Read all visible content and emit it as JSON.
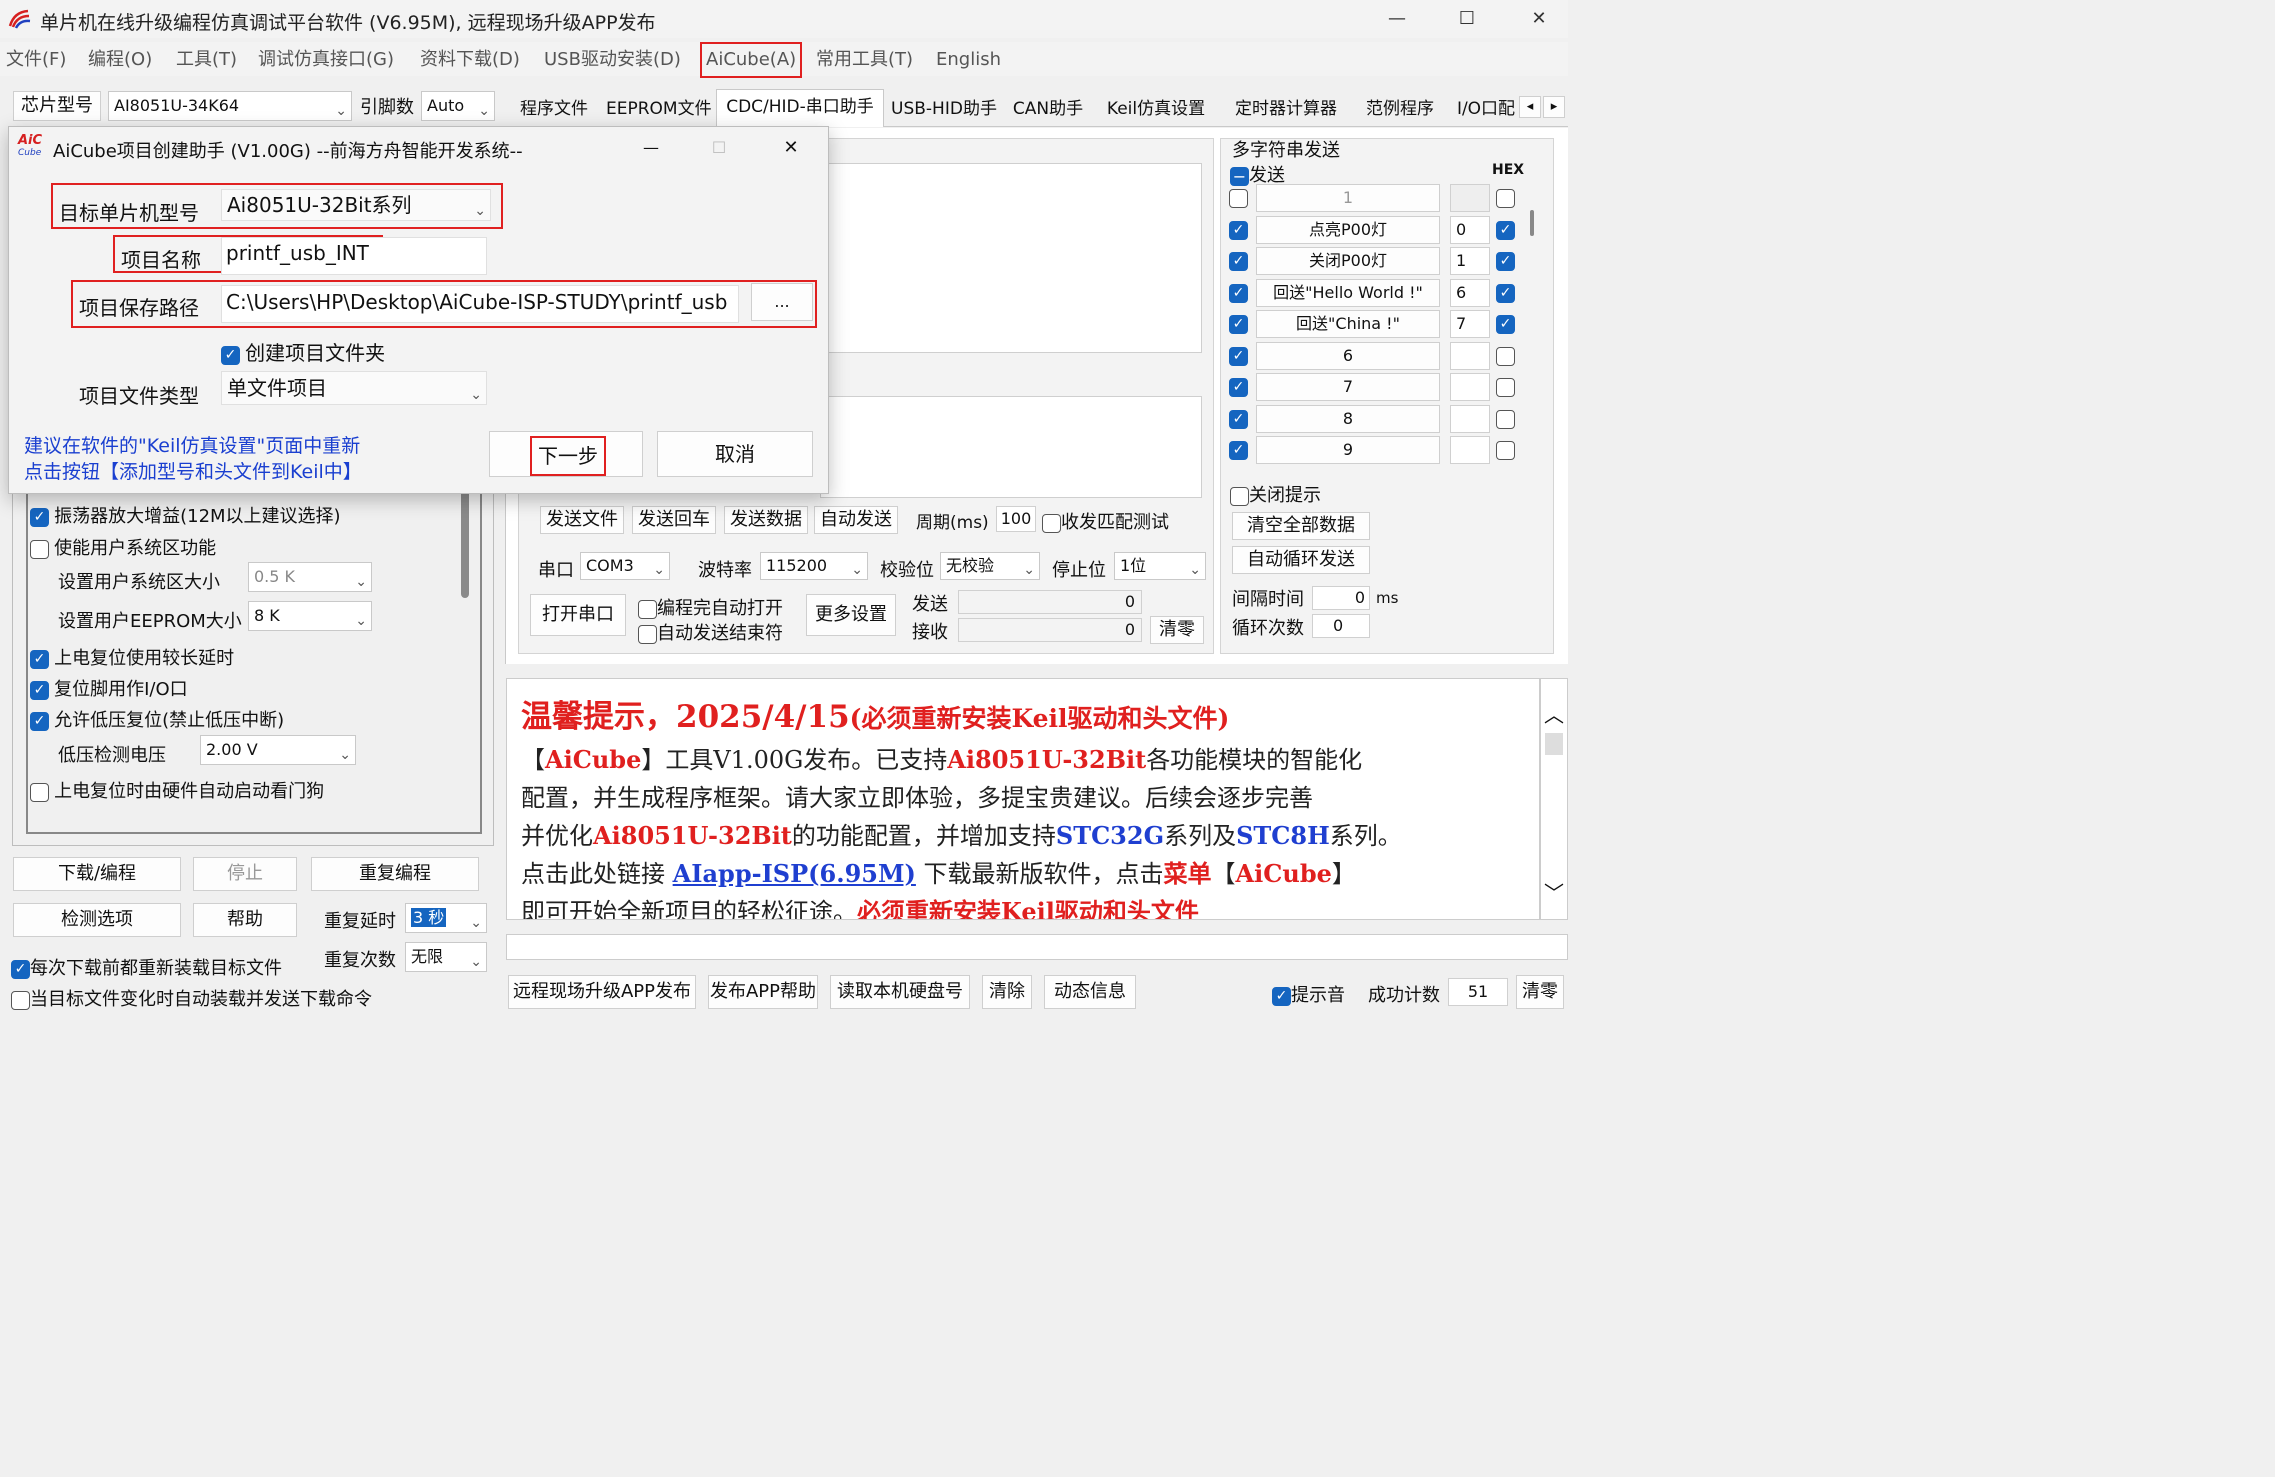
{
  "window": {
    "title": "单片机在线升级编程仿真调试平台软件 (V6.95M), 远程现场升级APP发布",
    "minimize": "—",
    "maximize": "☐",
    "close": "✕"
  },
  "menu": [
    "文件(F)",
    "编程(O)",
    "工具(T)",
    "调试仿真接口(G)",
    "资料下载(D)",
    "USB驱动安装(D)",
    "AiCube(A)",
    "常用工具(T)",
    "English"
  ],
  "left_top": {
    "chip_label": "芯片型号",
    "chip_value": "AI8051U-34K64",
    "pin_label": "引脚数",
    "pin_value": "Auto"
  },
  "tabs": [
    "程序文件",
    "EEPROM文件",
    "CDC/HID-串口助手",
    "USB-HID助手",
    "CAN助手",
    "Keil仿真设置",
    "定时器计算器",
    "范例程序",
    "I/O口配"
  ],
  "tab_nav": {
    "left": "◂",
    "right": "▸"
  },
  "dialog": {
    "title": "AiCube项目创建助手 (V1.00G) --前海方舟智能开发系统--",
    "icon_text": "AiC",
    "icon_sub": "Cube",
    "min": "—",
    "max": "☐",
    "close": "✕",
    "target_label": "目标单片机型号",
    "target_value": "Ai8051U-32Bit系列",
    "name_label": "项目名称",
    "name_value": "printf_usb_INT",
    "path_label": "项目保存路径",
    "path_value": "C:\\Users\\HP\\Desktop\\AiCube-ISP-STUDY\\printf_usb",
    "browse": "...",
    "create_folder": "创建项目文件夹",
    "type_label": "项目文件类型",
    "type_value": "单文件项目",
    "hint1": "建议在软件的\"Keil仿真设置\"页面中重新",
    "hint2": "点击按钮【添加型号和头文件到Keil中】",
    "next": "下一步",
    "cancel": "取消"
  },
  "options": [
    {
      "label": "振荡器放大增益(12M以上建议选择)",
      "checked": true
    },
    {
      "label": "使能用户系统区功能",
      "checked": false
    },
    {
      "label": "设置用户系统区大小",
      "combo": "0.5 K"
    },
    {
      "label": "设置用户EEPROM大小",
      "combo": "8   K"
    },
    {
      "label": "上电复位使用较长延时",
      "checked": true
    },
    {
      "label": "复位脚用作I/O口",
      "checked": true
    },
    {
      "label": "允许低压复位(禁止低压中断)",
      "checked": true
    },
    {
      "label": "低压检测电压",
      "combo": "2.00 V"
    },
    {
      "label": "上电复位时由硬件自动启动看门狗",
      "checked": false
    }
  ],
  "left_bottom": {
    "download": "下载/编程",
    "stop": "停止",
    "reprogram": "重复编程",
    "detect": "检测选项",
    "help": "帮助",
    "delay_label": "重复延时",
    "delay_value": "3 秒",
    "count_label": "重复次数",
    "count_value": "无限",
    "reload": "每次下载前都重新装载目标文件",
    "auto_send": "当目标文件变化时自动装载并发送下载命令"
  },
  "multi": {
    "title": "多字符串发送",
    "send": "发送",
    "hex": "HEX",
    "rows": [
      {
        "checked": false,
        "label": "1",
        "num": "",
        "hex": false
      },
      {
        "checked": true,
        "label": "点亮P00灯",
        "num": "0",
        "hex": true
      },
      {
        "checked": true,
        "label": "关闭P00灯",
        "num": "1",
        "hex": true
      },
      {
        "checked": true,
        "label": "回送\"Hello World !\"",
        "num": "6",
        "hex": true
      },
      {
        "checked": true,
        "label": "回送\"China !\"",
        "num": "7",
        "hex": true
      },
      {
        "checked": true,
        "label": "6",
        "num": "",
        "hex": false
      },
      {
        "checked": true,
        "label": "7",
        "num": "",
        "hex": false
      },
      {
        "checked": true,
        "label": "8",
        "num": "",
        "hex": false
      },
      {
        "checked": true,
        "label": "9",
        "num": "",
        "hex": false
      }
    ],
    "close_tip": "关闭提示",
    "clear_all": "清空全部数据",
    "auto_loop": "自动循环发送",
    "interval_label": "间隔时间",
    "interval_value": "0",
    "interval_unit": "ms",
    "loop_label": "循环次数",
    "loop_value": "0"
  },
  "serial": {
    "send_file": "发送文件",
    "send_cr": "发送回车",
    "send_data": "发送数据",
    "auto_send": "自动发送",
    "period_label": "周期(ms)",
    "period_value": "100",
    "match_test": "收发匹配测试",
    "port_label": "串口",
    "port_value": "COM3",
    "baud_label": "波特率",
    "baud_value": "115200",
    "parity_label": "校验位",
    "parity_value": "无校验",
    "stop_label": "停止位",
    "stop_value": "1位",
    "open": "打开串口",
    "auto_open": "编程完自动打开",
    "auto_end": "自动发送结束符",
    "more": "更多设置",
    "tx_label": "发送",
    "tx_value": "0",
    "rx_label": "接收",
    "rx_value": "0",
    "clear": "清零"
  },
  "notice": {
    "l1a": "温馨提示，2025/4/15",
    "l1b": "(必须重新安装Keil驱动和头文件)",
    "l2a": "【",
    "l2b": "AiCube",
    "l2c": "】工具V1.00G发布。已支持",
    "l2d": "Ai8051U-32Bit",
    "l2e": "各功能模块的智能化",
    "l3": "配置，并生成程序框架。请大家立即体验，多提宝贵建议。后续会逐步完善",
    "l4a": "并优化",
    "l4b": "Ai8051U-32Bit",
    "l4c": "的功能配置，并增加支持",
    "l4d": "STC32G",
    "l4e": "系列及",
    "l4f": "STC8H",
    "l4g": "系列。",
    "l5a": "点击此处链接 ",
    "l5b": "AIapp-ISP(6.95M)",
    "l5c": " 下载最新版软件，点击",
    "l5d": "菜单",
    "l5e": "【",
    "l5f": "AiCube",
    "l5g": "】",
    "l6a": "即可开始全新项目的轻松征途。",
    "l6b": "必须重新安装Keil驱动和头文件"
  },
  "bottom": {
    "remote": "远程现场升级APP发布",
    "publish_help": "发布APP帮助",
    "read_disk": "读取本机硬盘号",
    "clear": "清除",
    "dynamic": "动态信息",
    "sound": "提示音",
    "success_label": "成功计数",
    "success_value": "51",
    "reset": "清零"
  }
}
